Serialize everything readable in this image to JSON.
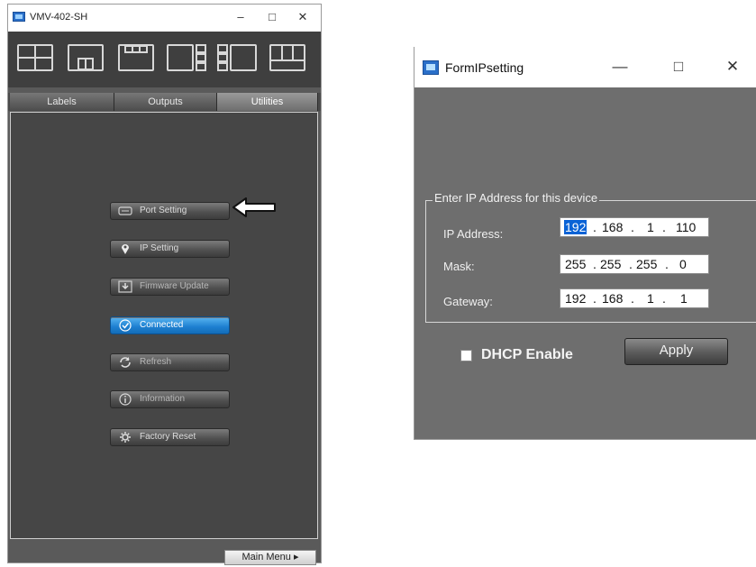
{
  "left_window": {
    "title": "VMV-402-SH",
    "minimize": "–",
    "maximize": "□",
    "close": "✕",
    "tabs": [
      {
        "label": "Labels"
      },
      {
        "label": "Outputs"
      },
      {
        "label": "Utilities"
      }
    ],
    "active_tab": "Utilities",
    "buttons": [
      {
        "label": "Port Setting",
        "icon": "port-icon"
      },
      {
        "label": "IP Setting",
        "icon": "location-pin-icon"
      },
      {
        "label": "Firmware Update",
        "icon": "download-icon"
      },
      {
        "label": "Connected",
        "icon": "check-circle-icon"
      },
      {
        "label": "Refresh",
        "icon": "refresh-icon"
      },
      {
        "label": "Information",
        "icon": "info-icon"
      },
      {
        "label": "Factory Reset",
        "icon": "gear-icon"
      }
    ],
    "main_menu": "Main Menu ▸",
    "accent_color": "#1d7fd0"
  },
  "right_window": {
    "title": "FormIPsetting",
    "minimize": "—",
    "maximize": "□",
    "close": "✕",
    "group_title": "Enter IP Address for this device",
    "fields": [
      {
        "label": "IP Address:",
        "octets": [
          "192",
          "168",
          "1",
          "110"
        ]
      },
      {
        "label": "Mask:",
        "octets": [
          "255",
          "255",
          "255",
          "0"
        ]
      },
      {
        "label": "Gateway:",
        "octets": [
          "192",
          "168",
          "1",
          "1"
        ]
      }
    ],
    "dhcp_label": "DHCP Enable",
    "dhcp_checked": false,
    "apply_label": "Apply"
  }
}
